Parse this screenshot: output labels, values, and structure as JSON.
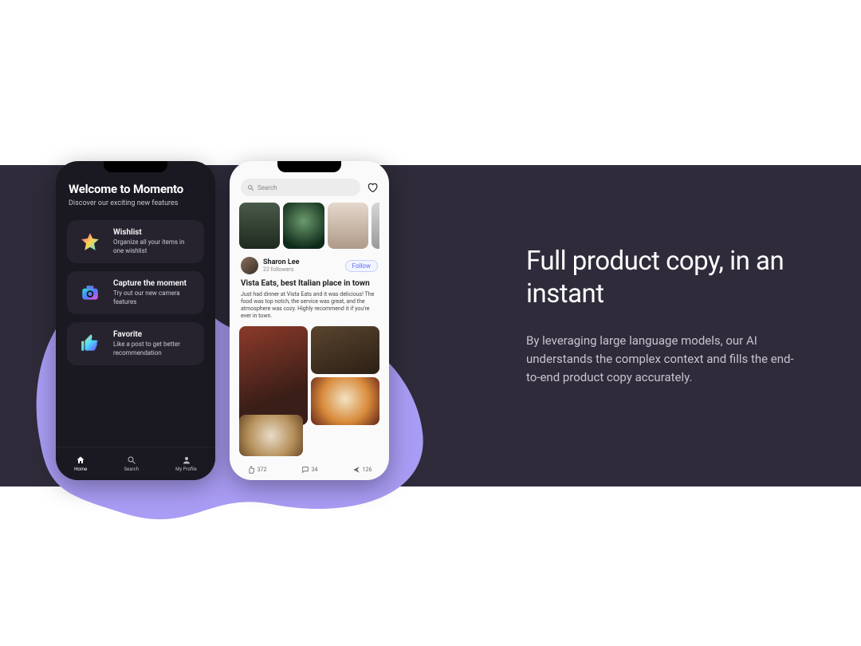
{
  "copy": {
    "heading": "Full product copy, in an instant",
    "paragraph": "By leveraging large language models, our AI understands the complex context and fills the end-to-end product copy accurately."
  },
  "phone1": {
    "title": "Welcome to Momento",
    "subtitle": "Discover our exciting new features",
    "features": [
      {
        "name": "Wishlist",
        "desc": "Organize all your items in one wishlist"
      },
      {
        "name": "Capture the moment",
        "desc": "Try out our new camera features"
      },
      {
        "name": "Favorite",
        "desc": "Like a post to get better recommendation"
      }
    ],
    "nav": [
      {
        "label": "Home"
      },
      {
        "label": "Search"
      },
      {
        "label": "My Profile"
      }
    ]
  },
  "phone2": {
    "search_placeholder": "Search",
    "profile": {
      "name": "Sharon Lee",
      "followers": "23 followers",
      "follow_btn": "Follow"
    },
    "post": {
      "title": "Vista Eats, best Italian place in town",
      "body": "Just had dinner at Vista Eats and it was delicious! The food was top notch, the service was great, and the atmosphere was cozy. Highly recommend it if you're ever in town."
    },
    "stats": {
      "likes": "372",
      "comments": "34",
      "shares": "126"
    }
  }
}
